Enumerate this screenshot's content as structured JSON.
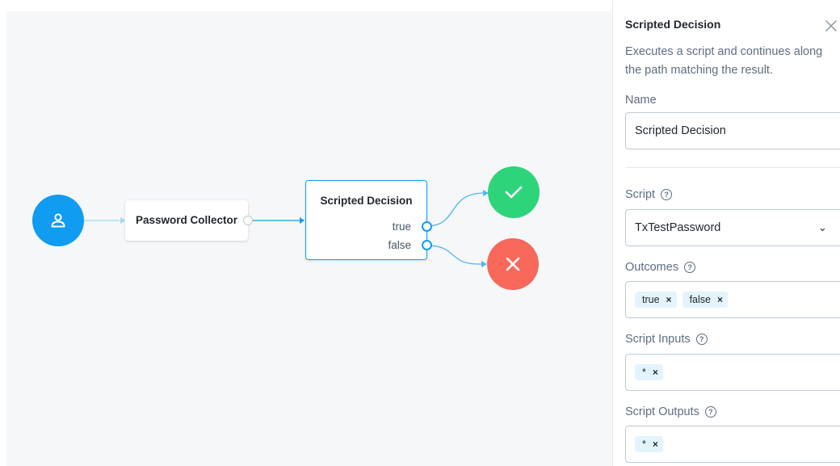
{
  "canvas": {
    "nodes": {
      "password_collector": "Password Collector",
      "scripted_decision": {
        "title": "Scripted Decision",
        "outcomes": [
          "true",
          "false"
        ]
      }
    },
    "colors": {
      "start": "#109cf1",
      "success": "#2ed47a",
      "failure": "#f7685b"
    },
    "icons": {
      "start": "user-icon",
      "success": "check-icon",
      "failure": "x-icon"
    }
  },
  "panel": {
    "title": "Scripted Decision",
    "description": "Executes a script and continues along the path matching the result.",
    "name": {
      "label": "Name",
      "value": "Scripted Decision"
    },
    "script": {
      "label": "Script",
      "value": "TxTestPassword"
    },
    "outcomes": {
      "label": "Outcomes",
      "chips": [
        "true",
        "false"
      ]
    },
    "script_inputs": {
      "label": "Script Inputs",
      "chips": [
        "*"
      ]
    },
    "script_outputs": {
      "label": "Script Outputs",
      "chips": [
        "*"
      ]
    }
  }
}
